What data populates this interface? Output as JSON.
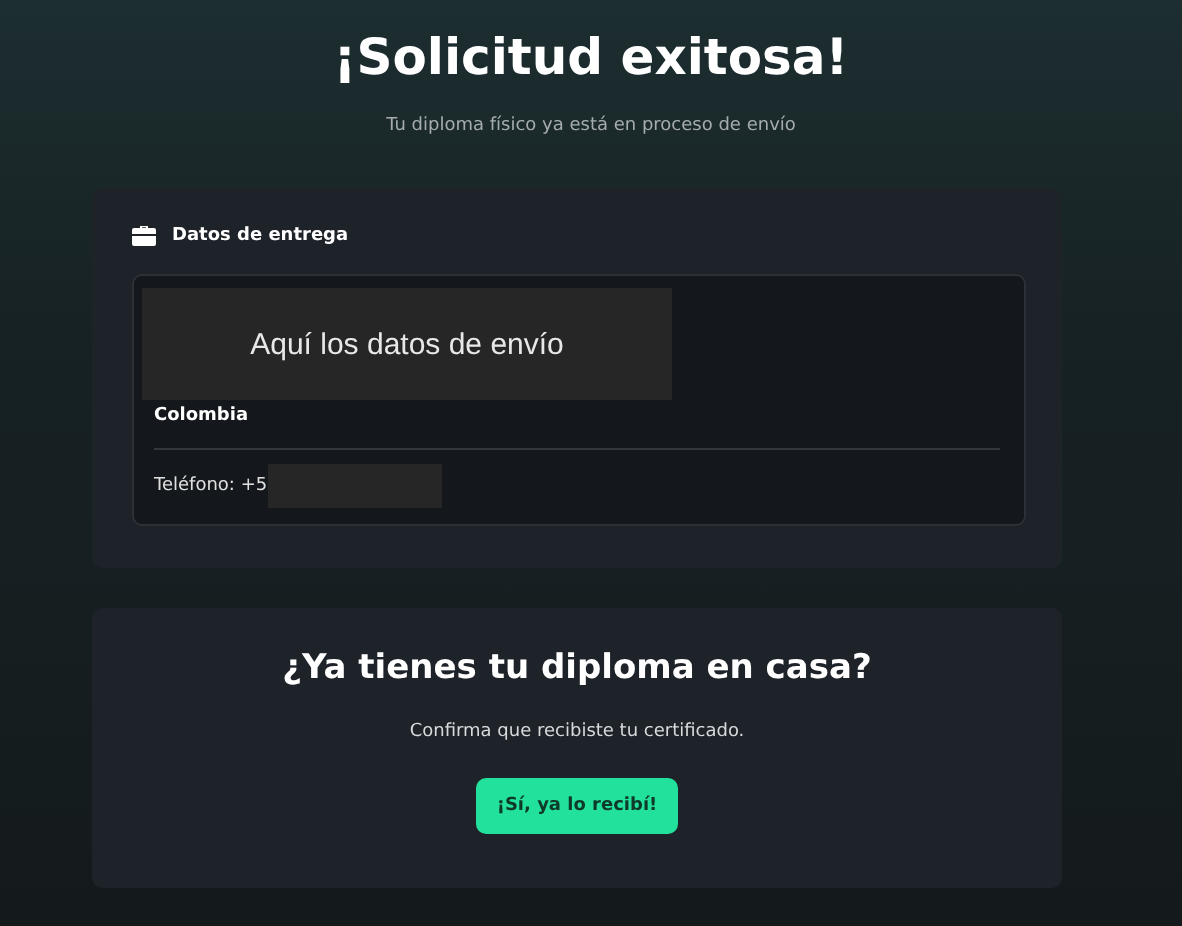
{
  "header": {
    "title": "¡Solicitud exitosa!",
    "subtitle": "Tu diploma físico ya está en proceso de envío"
  },
  "delivery": {
    "title": "Datos de entrega",
    "address_note": "Aquí los datos de envío",
    "country": "Colombia",
    "phone": "Teléfono: +5"
  },
  "confirm": {
    "title": "¿Ya tienes tu diploma en casa?",
    "text": "Confirma que recibiste tu certificado.",
    "button": "¡Sí, ya lo recibí!"
  }
}
